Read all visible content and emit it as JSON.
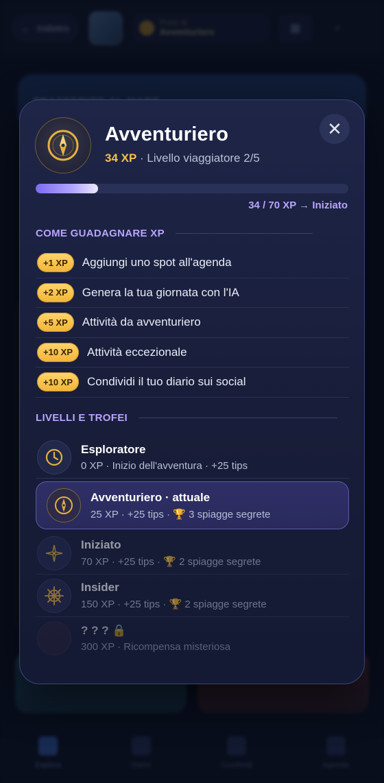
{
  "background": {
    "back_label": "Indietro",
    "points_title": "Punti di",
    "points_name": "Avventuriero",
    "banner_text": "TRASFERITO AL MARE",
    "nav": [
      {
        "label": "Esplora"
      },
      {
        "label": "Diario"
      },
      {
        "label": "Condividi"
      },
      {
        "label": "Agenda"
      }
    ]
  },
  "modal": {
    "title": "Avventuriero",
    "xp_value": "34 XP",
    "level_text": "· Livello viaggiatore 2/5",
    "close_symbol": "✕",
    "progress": {
      "current": 34,
      "target": 70,
      "fraction": 0.2,
      "text": "34 / 70 XP → Iniziato"
    },
    "earn_section_title": "COME GUADAGNARE XP",
    "earn_items": [
      {
        "xp": "+1 XP",
        "label": "Aggiungi uno spot all'agenda"
      },
      {
        "xp": "+2 XP",
        "label": "Genera la tua giornata con l'IA"
      },
      {
        "xp": "+5 XP",
        "label": "Attività da avventuriero"
      },
      {
        "xp": "+10 XP",
        "label": "Attività eccezionale"
      },
      {
        "xp": "+10 XP",
        "label": "Condividi il tuo diario sui social"
      }
    ],
    "levels_section_title": "LIVELLI E TROFEI",
    "levels": [
      {
        "name": "Esploratore",
        "meta": "0 XP · Inizio dell'avventura · +25 tips",
        "icon": "clock-icon",
        "state": "done"
      },
      {
        "name": "Avventuriero · attuale",
        "meta_prefix": "25 XP · +25 tips · ",
        "trophy": "🏆",
        "meta_suffix": " 3 spiagge segrete",
        "icon": "compass-icon",
        "state": "current"
      },
      {
        "name": "Iniziato",
        "meta_prefix": "70 XP · +25 tips · ",
        "trophy": "🏆",
        "meta_suffix": " 2 spiagge segrete",
        "icon": "compass-rose-icon",
        "state": "locked"
      },
      {
        "name": "Insider",
        "meta_prefix": "150 XP · +25 tips · ",
        "trophy": "🏆",
        "meta_suffix": " 2 spiagge segrete",
        "icon": "ship-wheel-icon",
        "state": "locked"
      },
      {
        "name": "? ? ?",
        "lock": "🔒",
        "meta": "300 XP · Ricompensa misteriosa",
        "icon": "mystery-icon",
        "state": "mystery"
      }
    ],
    "colors": {
      "accent": "#b8a4ff",
      "xp_gold": "#f3c14d"
    }
  }
}
